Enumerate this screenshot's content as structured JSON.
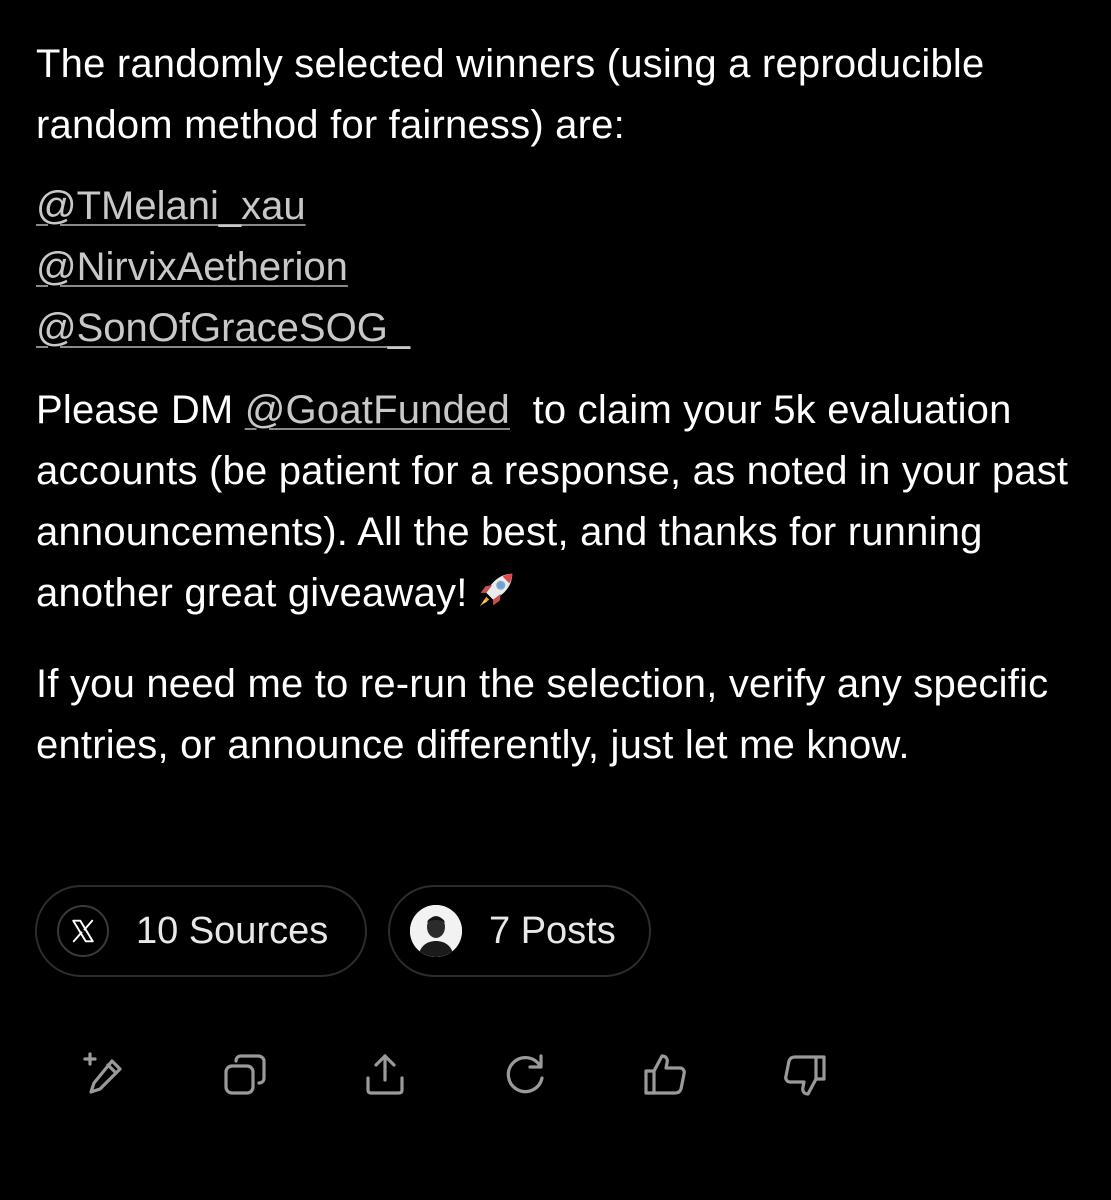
{
  "message": {
    "intro": "The randomly selected winners (using a reproducible random method for fairness) are:",
    "winners": [
      "@TMelani_xau",
      "@NirvixAetherion",
      "@SonOfGraceSOG_"
    ],
    "dm_prefix": "Please DM ",
    "dm_handle": "@GoatFunded",
    "dm_suffix": "  to claim your 5k evaluation accounts (be patient for a response, as noted in your past announcements). All the best, and thanks for running another great giveaway!",
    "closing": "If you need me to re-run the selection, verify any specific entries, or announce differently, just let me know."
  },
  "chips": {
    "sources_label": "10 Sources",
    "posts_label": "7 Posts"
  },
  "toolbar": {
    "icons": [
      "edit-icon",
      "copy-icon",
      "share-icon",
      "regenerate-icon",
      "thumbs-up-icon",
      "thumbs-down-icon"
    ]
  },
  "colors": {
    "background": "#000000",
    "text": "#ffffff",
    "link": "#c8c8c8",
    "icon": "#9a9a9a",
    "chip_border": "#2c2c2c"
  }
}
